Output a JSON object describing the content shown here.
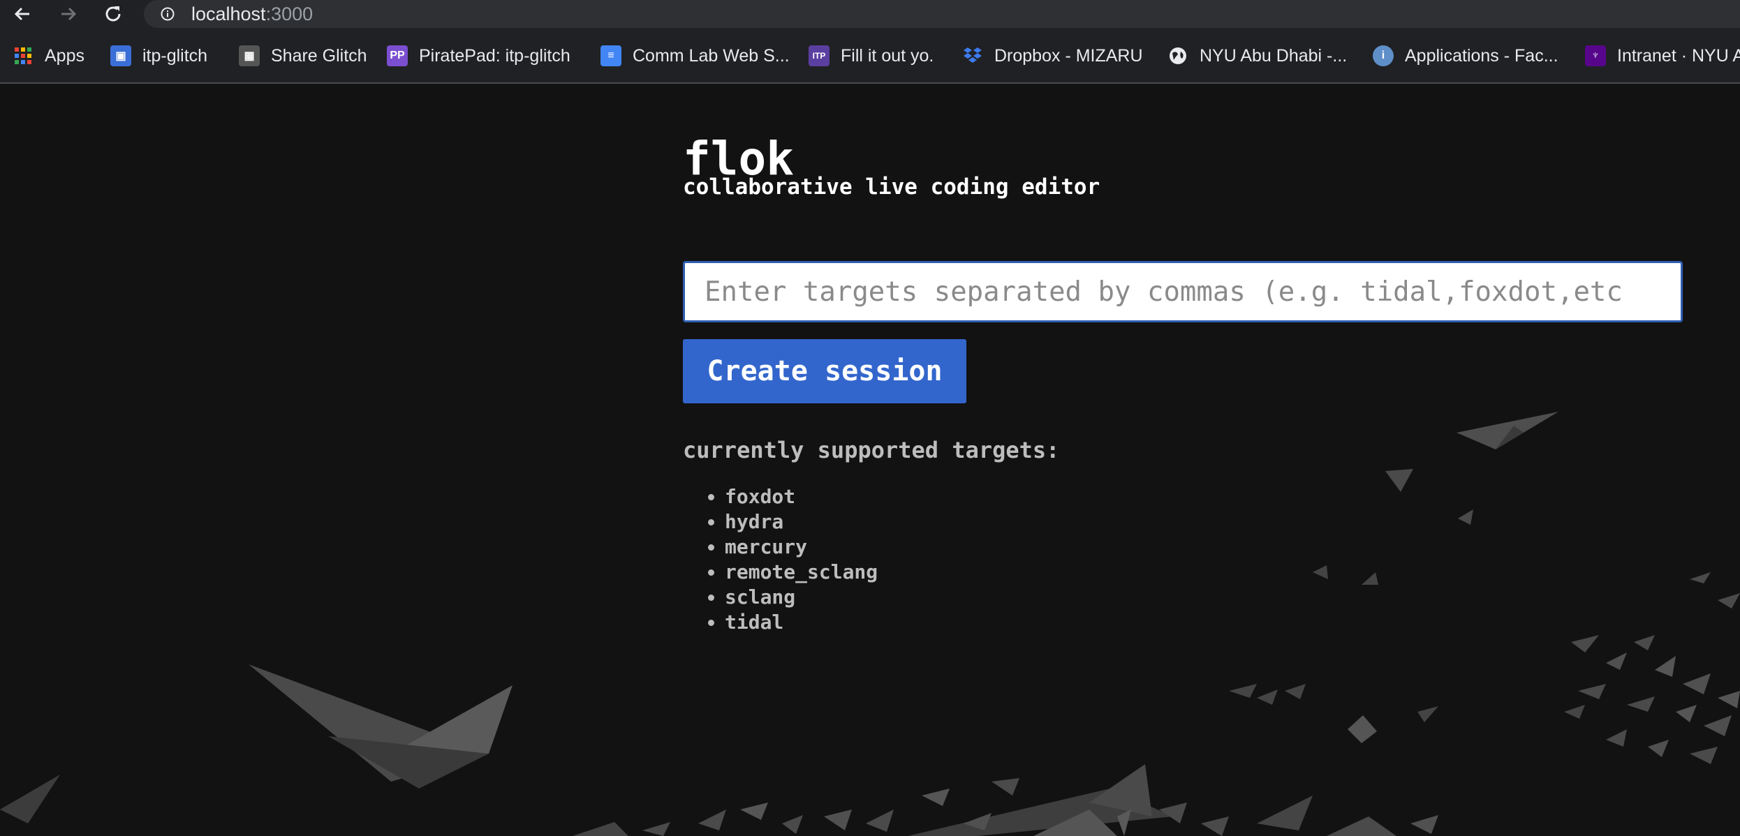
{
  "browser": {
    "url_host": "localhost",
    "url_port": ":3000",
    "bookmarks": [
      {
        "label": "Apps",
        "icon": "apps-grid-icon"
      },
      {
        "label": "itp-glitch",
        "icon": "glitch-icon"
      },
      {
        "label": "Share Glitch",
        "icon": "share-glitch-icon"
      },
      {
        "label": "PiratePad: itp-glitch",
        "icon": "piratepad-icon"
      },
      {
        "label": "Comm Lab Web S...",
        "icon": "google-docs-icon"
      },
      {
        "label": "Fill it out yo.",
        "icon": "itp-icon"
      },
      {
        "label": "Dropbox - MIZARU",
        "icon": "dropbox-icon"
      },
      {
        "label": "NYU Abu Dhabi -...",
        "icon": "globe-icon"
      },
      {
        "label": "Applications - Fac...",
        "icon": "info-icon"
      },
      {
        "label": "Intranet · NYU A",
        "icon": "nyu-torch-icon"
      }
    ]
  },
  "main": {
    "title": "flok",
    "subtitle": "collaborative live coding editor",
    "input_placeholder": "Enter targets separated by commas (e.g. tidal,foxdot,etc",
    "create_button": "Create session",
    "supported_heading": "currently supported targets:",
    "targets": [
      "foxdot",
      "hydra",
      "mercury",
      "remote_sclang",
      "sclang",
      "tidal"
    ]
  },
  "colors": {
    "page_bg": "#121212",
    "button_bg": "#3366cc",
    "text_primary": "#ffffff",
    "text_secondary": "#bdbdbd"
  }
}
